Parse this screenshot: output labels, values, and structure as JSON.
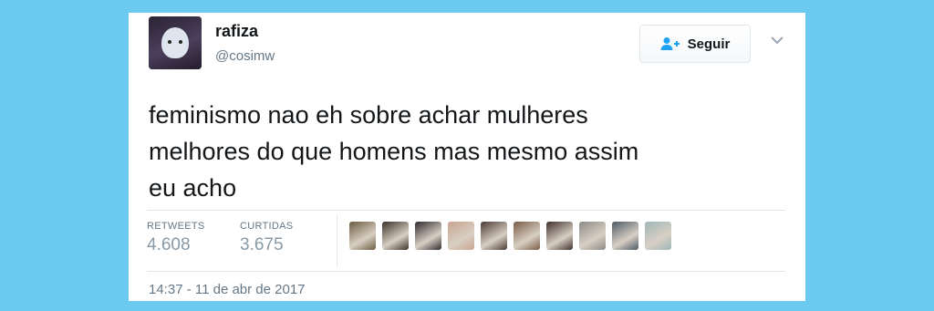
{
  "user": {
    "display_name": "rafiza",
    "handle": "@cosimw"
  },
  "follow_button": {
    "label": "Seguir",
    "icon": "follow-person-plus-icon"
  },
  "menu_icon": "chevron-down-icon",
  "tweet": {
    "lines": [
      "feminismo nao eh sobre achar mulheres",
      "melhores do que homens mas mesmo assim",
      "eu acho"
    ]
  },
  "stats": {
    "retweets": {
      "label": "RETWEETS",
      "value": "4.608"
    },
    "likes": {
      "label": "CURTIDAS",
      "value": "3.675"
    }
  },
  "likers": [
    {
      "color": "#6b5a3e"
    },
    {
      "color": "#3b3027"
    },
    {
      "color": "#2f2a2e"
    },
    {
      "color": "#c9a48e"
    },
    {
      "color": "#4a3a33"
    },
    {
      "color": "#7a5b45"
    },
    {
      "color": "#3e2f2a"
    },
    {
      "color": "#8c8a86"
    },
    {
      "color": "#4c5a64"
    },
    {
      "color": "#9fb6b8"
    }
  ],
  "timestamp": "14:37 - 11 de abr de 2017",
  "colors": {
    "background": "#6cc9f0",
    "text": "#14171a",
    "secondary_text": "#657786",
    "follow_icon": "#1da1f2"
  }
}
